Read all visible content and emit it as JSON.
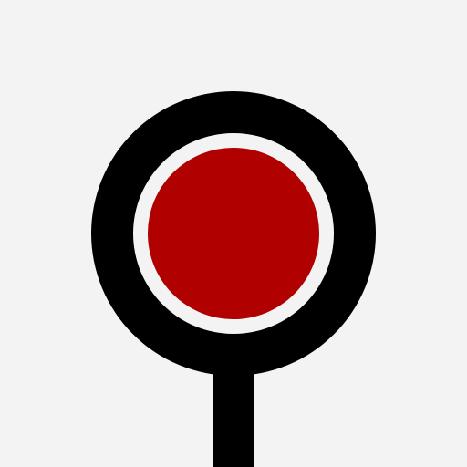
{
  "icon": {
    "name": "round-signal-disc-icon",
    "colors": {
      "background": "#f3f3f3",
      "outline": "#000000",
      "inner_ring": "#f3f3f3",
      "disc": "#b00000"
    }
  }
}
